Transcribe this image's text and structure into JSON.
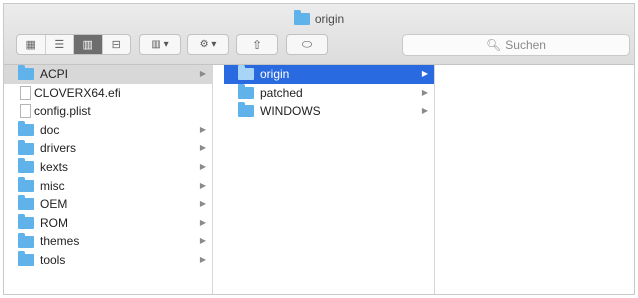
{
  "window": {
    "title": "origin"
  },
  "toolbar": {
    "view_icons": [
      "icon-view",
      "list-view",
      "column-view",
      "coverflow-view"
    ],
    "active_view": "column-view",
    "group_label": "▥ ▾",
    "action_label": "⚙ ▾",
    "share_label": "⇧",
    "tag_label": "⬭"
  },
  "search": {
    "placeholder": "Suchen"
  },
  "columns": {
    "col1": [
      {
        "name": "ACPI",
        "kind": "folder",
        "selected": "gray"
      },
      {
        "name": "CLOVERX64.efi",
        "kind": "file"
      },
      {
        "name": "config.plist",
        "kind": "file"
      },
      {
        "name": "doc",
        "kind": "folder"
      },
      {
        "name": "drivers",
        "kind": "folder"
      },
      {
        "name": "kexts",
        "kind": "folder"
      },
      {
        "name": "misc",
        "kind": "folder"
      },
      {
        "name": "OEM",
        "kind": "folder"
      },
      {
        "name": "ROM",
        "kind": "folder"
      },
      {
        "name": "themes",
        "kind": "folder"
      },
      {
        "name": "tools",
        "kind": "folder"
      }
    ],
    "col2": [
      {
        "name": "origin",
        "kind": "folder",
        "selected": "blue"
      },
      {
        "name": "patched",
        "kind": "folder"
      },
      {
        "name": "WINDOWS",
        "kind": "folder"
      }
    ]
  },
  "colors": {
    "selection_blue": "#2a6ae0",
    "selection_gray": "#d8d8d8",
    "folder_blue": "#5fb2ea"
  }
}
